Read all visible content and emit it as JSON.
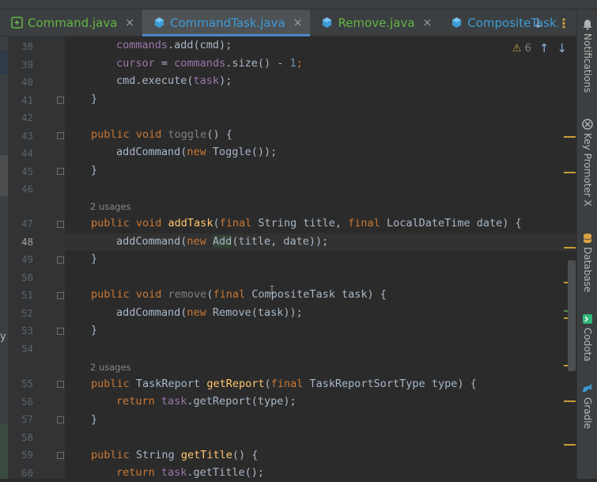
{
  "tabs": [
    {
      "label": "Command.java",
      "icon": "interface-icon",
      "active": false
    },
    {
      "label": "CommandTask.java",
      "icon": "class-icon",
      "active": true
    },
    {
      "label": "Remove.java",
      "icon": "class-icon",
      "active": false
    },
    {
      "label": "CompositeTask.j",
      "icon": "class-icon",
      "active": false
    }
  ],
  "tab_close_glyph": "×",
  "tab_actions": {
    "more_tabs_glyph": "↓",
    "more_menu_glyph": "⋮"
  },
  "inspection": {
    "warning_count": "6",
    "warning_glyph": "⚠",
    "prev_glyph": "↑",
    "next_glyph": "↓"
  },
  "left_panel_glyph": "y",
  "gutter": {
    "line_numbers": [
      "38",
      "39",
      "40",
      "41",
      "42",
      "43",
      "44",
      "45",
      "46",
      "47",
      "48",
      "49",
      "50",
      "51",
      "52",
      "53",
      "54",
      "55",
      "56",
      "57",
      "58",
      "59",
      "60"
    ],
    "current_line": "48"
  },
  "usages_hints": [
    "2 usages",
    "2 usages"
  ],
  "code": {
    "l38": {
      "t1": "commands",
      "t2": ".add(cmd);"
    },
    "l39": {
      "t1": "cursor",
      "t2": " = ",
      "t3": "commands",
      "t4": ".size() - ",
      "t5": "1",
      "t6": ";"
    },
    "l40": {
      "t1": "cmd.execute(",
      "t2": "task",
      "t3": ");"
    },
    "l41": {
      "t1": "}"
    },
    "l43": {
      "t1": "public void ",
      "t2": "toggle",
      "t3": "() {"
    },
    "l44": {
      "t1": "addCommand(",
      "t2": "new ",
      "t3": "Toggle());"
    },
    "l45": {
      "t1": "}"
    },
    "l47": {
      "t1": "public void ",
      "t2": "addTask",
      "t3": "(",
      "t4": "final ",
      "t5": "String title, ",
      "t6": "final ",
      "t7": "LocalDateTime date) {"
    },
    "l48": {
      "t1": "addCommand(",
      "t2": "new ",
      "t3": "Add",
      "t4": "(title, date));"
    },
    "l49": {
      "t1": "}"
    },
    "l51": {
      "t1": "public void ",
      "t2": "remove",
      "t3": "(",
      "t4": "final ",
      "t5": "CompositeTask task) {"
    },
    "l52": {
      "t1": "addCommand(",
      "t2": "new ",
      "t3": "Remove(task));"
    },
    "l53": {
      "t1": "}"
    },
    "l55": {
      "t1": "public ",
      "t2": "TaskReport ",
      "t3": "getReport",
      "t4": "(",
      "t5": "final ",
      "t6": "TaskReportSortType type) {"
    },
    "l56": {
      "t1": "return ",
      "t2": "task",
      "t3": ".getReport(type);"
    },
    "l57": {
      "t1": "}"
    },
    "l59": {
      "t1": "public ",
      "t2": "String ",
      "t3": "getTitle",
      "t4": "() {"
    },
    "l60": {
      "t1": "return ",
      "t2": "task",
      "t3": ".getTitle();"
    }
  },
  "right_tools": [
    {
      "label": "Notifications",
      "icon": "bell-icon"
    },
    {
      "label": "Key Promoter X",
      "icon": "key-promoter-icon"
    },
    {
      "label": "Database",
      "icon": "database-icon"
    },
    {
      "label": "Codota",
      "icon": "codota-icon"
    },
    {
      "label": "Gradle",
      "icon": "gradle-icon"
    }
  ],
  "colors": {
    "keyword": "#cc7832",
    "method": "#ffc66d",
    "field": "#9876aa",
    "number": "#6897bb",
    "text": "#a9b7c6",
    "active_tab_accent": "#4a88c7",
    "warning_marker": "#c79d35"
  }
}
